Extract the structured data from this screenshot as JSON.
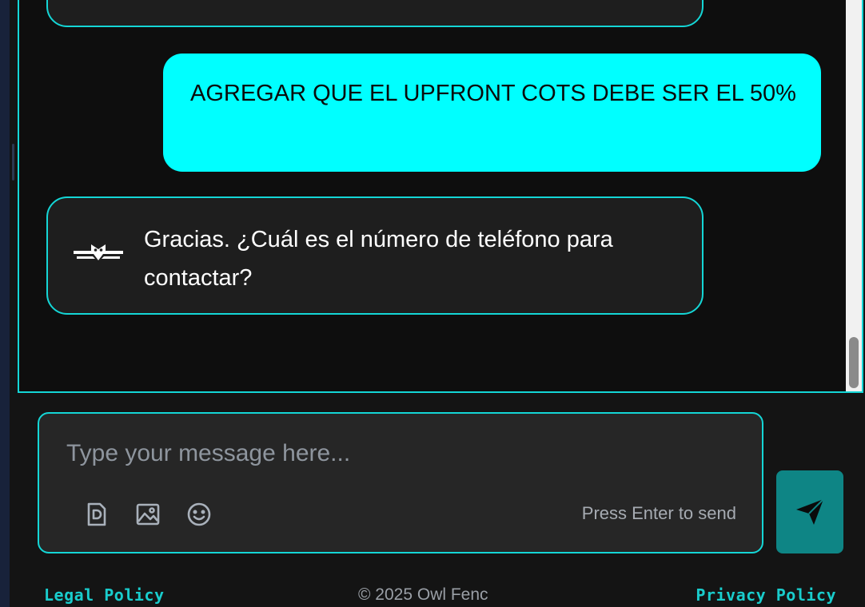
{
  "messages": [
    {
      "role": "user",
      "text": "AGREGAR QUE EL UPFRONT COTS DEBE SER EL 50%"
    },
    {
      "role": "assistant",
      "text": "Gracias. ¿Cuál es el número de teléfono para contactar?"
    }
  ],
  "composer": {
    "placeholder": "Type your message here...",
    "hint": "Press Enter to send",
    "tools": [
      "document-icon",
      "image-icon",
      "emoji-icon"
    ]
  },
  "footer": {
    "legal_label": "Legal Policy",
    "copyright": "© 2025 Owl Fenc",
    "privacy_label": "Privacy Policy"
  },
  "colors": {
    "accent": "#14d6d6",
    "user_bubble": "#00ffff",
    "send_button": "#0e8585",
    "background": "#0e0e0e"
  }
}
